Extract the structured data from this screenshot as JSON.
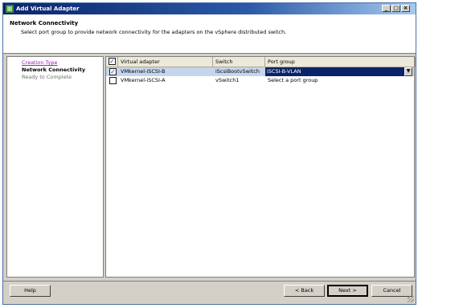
{
  "window": {
    "title": "Add Virtual Adapter",
    "buttons": [
      "_",
      "□",
      "×"
    ]
  },
  "header": {
    "title": "Network Connectivity",
    "subtitle": "Select port group to provide network connectivity for the adapters on the vSphere distributed switch."
  },
  "nav": {
    "items": [
      {
        "label": "Creation Type",
        "state": "link"
      },
      {
        "label": "Network Connectivity",
        "state": "current"
      },
      {
        "label": "Ready to Complete",
        "state": "disabled"
      }
    ]
  },
  "table": {
    "columns": [
      "Virtual adapter",
      "Switch",
      "Port group"
    ],
    "rows": [
      {
        "checked": true,
        "adapter": "VMkernel-iSCSI-B",
        "switch": "iScsiBootvSwitch",
        "port_group": "iSCSI-B-VLAN"
      },
      {
        "checked": false,
        "adapter": "VMkernel-iSCSI-A",
        "switch": "vSwitch1",
        "port_group": "Select a port group"
      }
    ]
  },
  "buttons": {
    "help": "Help",
    "back": "< Back",
    "next": "Next >",
    "cancel": "Cancel"
  },
  "colors": {
    "titlebar": "#0a246a",
    "selection": "#c5d5ec",
    "link": "#9a1fb0"
  }
}
